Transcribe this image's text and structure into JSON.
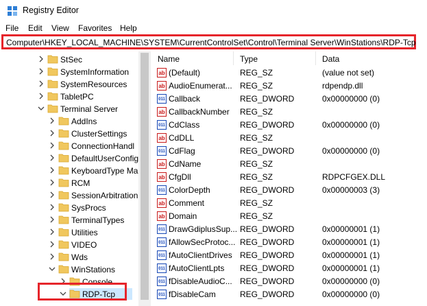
{
  "window": {
    "title": "Registry Editor"
  },
  "menu": [
    "File",
    "Edit",
    "View",
    "Favorites",
    "Help"
  ],
  "address": {
    "path": "Computer\\HKEY_LOCAL_MACHINE\\SYSTEM\\CurrentControlSet\\Control\\Terminal Server\\WinStations\\RDP-Tcp"
  },
  "tree": [
    {
      "label": "StSec",
      "expanded": false
    },
    {
      "label": "SystemInformation",
      "expanded": false
    },
    {
      "label": "SystemResources",
      "expanded": false
    },
    {
      "label": "TabletPC",
      "expanded": false
    },
    {
      "label": "Terminal Server",
      "expanded": true
    },
    {
      "label": "AddIns",
      "expanded": false
    },
    {
      "label": "ClusterSettings",
      "expanded": false
    },
    {
      "label": "ConnectionHandl",
      "expanded": false
    },
    {
      "label": "DefaultUserConfig",
      "expanded": false
    },
    {
      "label": "KeyboardType Ma",
      "expanded": false
    },
    {
      "label": "RCM",
      "expanded": false
    },
    {
      "label": "SessionArbitration",
      "expanded": false
    },
    {
      "label": "SysProcs",
      "expanded": false
    },
    {
      "label": "TerminalTypes",
      "expanded": false
    },
    {
      "label": "Utilities",
      "expanded": false
    },
    {
      "label": "VIDEO",
      "expanded": false
    },
    {
      "label": "Wds",
      "expanded": false
    },
    {
      "label": "WinStations",
      "expanded": true
    },
    {
      "label": "Console",
      "expanded": false
    },
    {
      "label": "RDP-Tcp",
      "expanded": true,
      "selected": true
    }
  ],
  "columns": {
    "name": "Name",
    "type": "Type",
    "data": "Data"
  },
  "values": [
    {
      "name": "(Default)",
      "type": "REG_SZ",
      "data": "(value not set)",
      "icon": "sz"
    },
    {
      "name": "AudioEnumerat...",
      "type": "REG_SZ",
      "data": "rdpendp.dll",
      "icon": "sz"
    },
    {
      "name": "Callback",
      "type": "REG_DWORD",
      "data": "0x00000000 (0)",
      "icon": "dw"
    },
    {
      "name": "CallbackNumber",
      "type": "REG_SZ",
      "data": "",
      "icon": "sz"
    },
    {
      "name": "CdClass",
      "type": "REG_DWORD",
      "data": "0x00000000 (0)",
      "icon": "dw"
    },
    {
      "name": "CdDLL",
      "type": "REG_SZ",
      "data": "",
      "icon": "sz"
    },
    {
      "name": "CdFlag",
      "type": "REG_DWORD",
      "data": "0x00000000 (0)",
      "icon": "dw"
    },
    {
      "name": "CdName",
      "type": "REG_SZ",
      "data": "",
      "icon": "sz"
    },
    {
      "name": "CfgDll",
      "type": "REG_SZ",
      "data": "RDPCFGEX.DLL",
      "icon": "sz"
    },
    {
      "name": "ColorDepth",
      "type": "REG_DWORD",
      "data": "0x00000003 (3)",
      "icon": "dw"
    },
    {
      "name": "Comment",
      "type": "REG_SZ",
      "data": "",
      "icon": "sz"
    },
    {
      "name": "Domain",
      "type": "REG_SZ",
      "data": "",
      "icon": "sz"
    },
    {
      "name": "DrawGdiplusSup...",
      "type": "REG_DWORD",
      "data": "0x00000001 (1)",
      "icon": "dw"
    },
    {
      "name": "fAllowSecProtoc...",
      "type": "REG_DWORD",
      "data": "0x00000001 (1)",
      "icon": "dw"
    },
    {
      "name": "fAutoClientDrives",
      "type": "REG_DWORD",
      "data": "0x00000001 (1)",
      "icon": "dw"
    },
    {
      "name": "fAutoClientLpts",
      "type": "REG_DWORD",
      "data": "0x00000001 (1)",
      "icon": "dw"
    },
    {
      "name": "fDisableAudioC...",
      "type": "REG_DWORD",
      "data": "0x00000000 (0)",
      "icon": "dw"
    },
    {
      "name": "fDisableCam",
      "type": "REG_DWORD",
      "data": "0x00000000 (0)",
      "icon": "dw"
    }
  ],
  "colors": {
    "highlight": "#e6252b",
    "folder": "#f0c75e",
    "selection": "#cce8ff"
  }
}
